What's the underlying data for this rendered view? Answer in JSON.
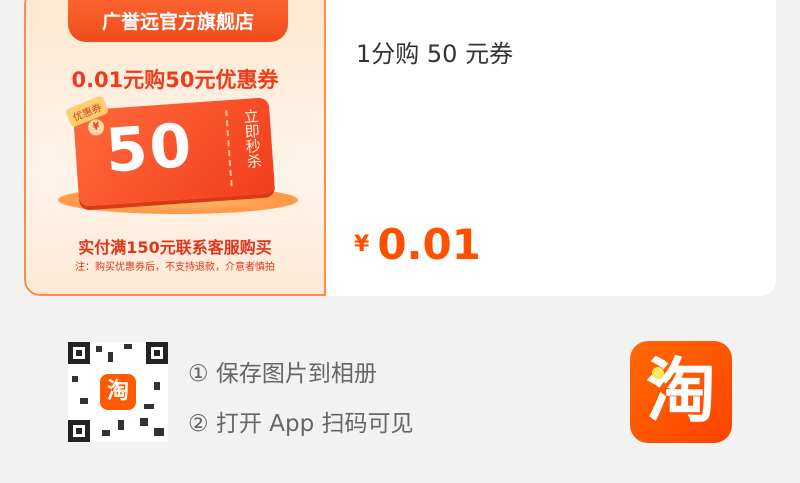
{
  "product": {
    "shop_name": "广誉远官方旗舰店",
    "promo_title": "0.01元购50元优惠券",
    "ticket_tag": "优惠券",
    "ticket_currency": "¥",
    "ticket_value": "50",
    "ticket_cta": "立即秒杀",
    "promo_condition": "实付满150元联系客服购买",
    "promo_note": "注：购买优惠券后，不支持退款，介意者慎拍",
    "title": "1分购 50 元券",
    "price_symbol": "¥",
    "price_value": "0.01"
  },
  "instructions": {
    "qr_logo": "淘",
    "step1": "① 保存图片到相册",
    "step2": "② 打开 App 扫码可见"
  },
  "app_icon": {
    "glyph": "淘",
    "color": "#ff5000"
  },
  "colors": {
    "accent": "#ff5000",
    "promo_red": "#ee3b1b",
    "background": "#f2f2f2"
  }
}
